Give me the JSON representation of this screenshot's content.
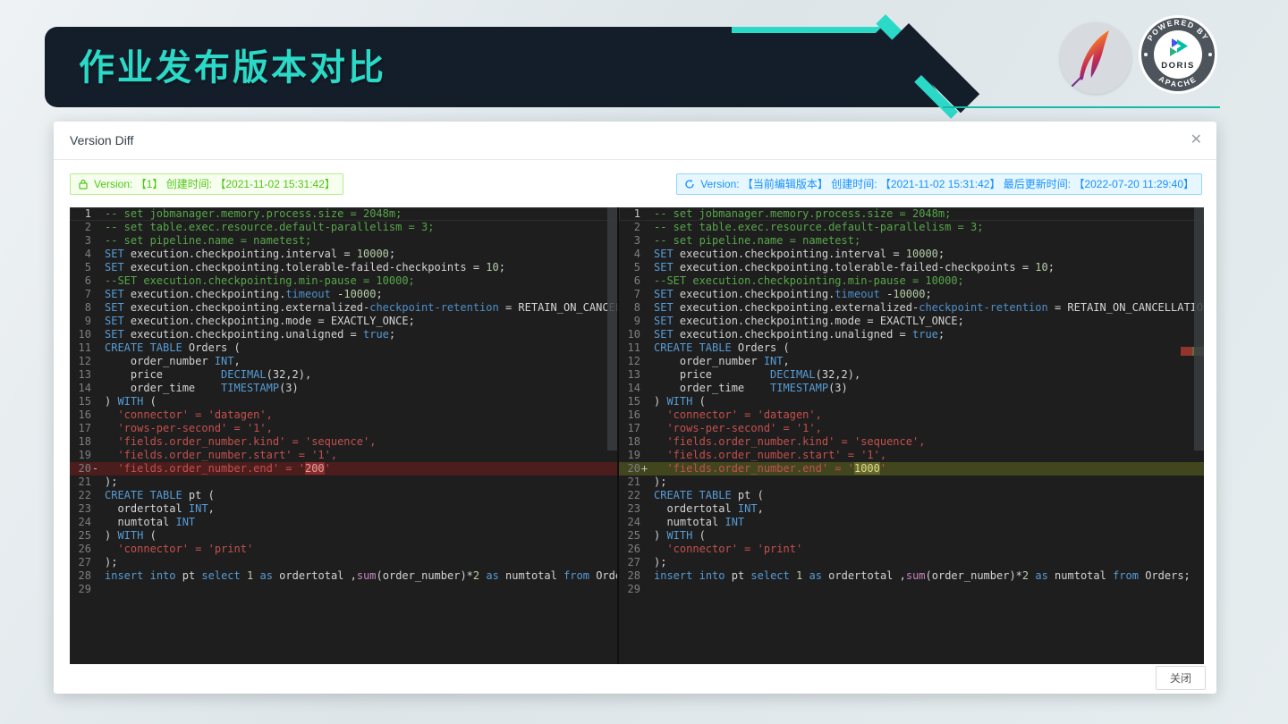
{
  "slide": {
    "title": "作业发布版本对比"
  },
  "logos": {
    "apache_feather": "apache-feather-icon",
    "doris_ring_top": "POWERED BY",
    "doris_ring_bottom": "APACHE",
    "doris_center": "DORIS"
  },
  "dialog": {
    "title": "Version Diff",
    "close_icon": "✕",
    "left_version_label": "Version: 【1】 创建时间: 【2021-11-02 15:31:42】",
    "right_version_label": "Version: 【当前编辑版本】 创建时间: 【2021-11-02 15:31:42】 最后更新时间: 【2022-07-20 11:29:40】",
    "close_button_label": "关闭"
  },
  "colors": {
    "accent_teal": "#2BD9C7",
    "header_dark": "#141E2B",
    "badge_green": "#52C41A",
    "badge_blue": "#1890FF",
    "editor_bg": "#1E1E1E",
    "diff_delete_row": "#4B1D1D",
    "diff_delete_char": "#8A2B2B",
    "diff_insert_row": "#41461F",
    "diff_insert_char": "#63692B"
  },
  "editor": {
    "diff_line_number": 20,
    "left_sign": "-",
    "right_sign": "+",
    "left_line_20": [
      [
        "s",
        "  'fields.order_number.end' = '"
      ],
      [
        "sv",
        "200"
      ],
      [
        "s",
        "'"
      ]
    ],
    "right_line_20": [
      [
        "s",
        "  'fields.order_number.end' = '"
      ],
      [
        "sv",
        "1000"
      ],
      [
        "s",
        "'"
      ]
    ],
    "lines": [
      [
        [
          "c",
          "-- set jobmanager.memory.process.size = 2048m;"
        ]
      ],
      [
        [
          "c",
          "-- set table.exec.resource.default-parallelism = 3;"
        ]
      ],
      [
        [
          "c",
          "-- set pipeline.name = nametest;"
        ]
      ],
      [
        [
          "k",
          "SET"
        ],
        [
          "t",
          " execution.checkpointing.interval = "
        ],
        [
          "n",
          "10000"
        ],
        [
          "t",
          ";"
        ]
      ],
      [
        [
          "k",
          "SET"
        ],
        [
          "t",
          " execution.checkpointing.tolerable-failed-checkpoints = "
        ],
        [
          "n",
          "10"
        ],
        [
          "t",
          ";"
        ]
      ],
      [
        [
          "c",
          "--SET execution.checkpointing.min-pause = 10000;"
        ]
      ],
      [
        [
          "k",
          "SET"
        ],
        [
          "t",
          " execution.checkpointing."
        ],
        [
          "k2",
          "timeout"
        ],
        [
          "t",
          " -"
        ],
        [
          "n",
          "10000"
        ],
        [
          "t",
          ";"
        ]
      ],
      [
        [
          "k",
          "SET"
        ],
        [
          "t",
          " execution.checkpointing.externalized-"
        ],
        [
          "k2",
          "checkpoint-retention"
        ],
        [
          "t",
          " = RETAIN_ON_CANCELLATION;"
        ]
      ],
      [
        [
          "k",
          "SET"
        ],
        [
          "t",
          " execution.checkpointing.mode = EXACTLY_ONCE;"
        ]
      ],
      [
        [
          "k",
          "SET"
        ],
        [
          "t",
          " execution.checkpointing.unaligned = "
        ],
        [
          "k",
          "true"
        ],
        [
          "t",
          ";"
        ]
      ],
      [
        [
          "k",
          "CREATE TABLE"
        ],
        [
          "t",
          " Orders ("
        ]
      ],
      [
        [
          "t",
          "    order_number "
        ],
        [
          "k",
          "INT"
        ],
        [
          "t",
          ","
        ]
      ],
      [
        [
          "t",
          "    price         "
        ],
        [
          "k",
          "DECIMAL"
        ],
        [
          "t",
          "(32,2),"
        ]
      ],
      [
        [
          "t",
          "    order_time    "
        ],
        [
          "k",
          "TIMESTAMP"
        ],
        [
          "t",
          "(3)"
        ]
      ],
      [
        [
          "t",
          ") "
        ],
        [
          "k",
          "WITH"
        ],
        [
          "t",
          " ("
        ]
      ],
      [
        [
          "s",
          "  'connector' = 'datagen',"
        ]
      ],
      [
        [
          "s",
          "  'rows-per-second' = '1',"
        ]
      ],
      [
        [
          "s",
          "  'fields.order_number.kind' = 'sequence',"
        ]
      ],
      [
        [
          "s",
          "  'fields.order_number.start' = '1',"
        ]
      ],
      {
        "diff": true
      },
      [
        [
          "t",
          ");"
        ]
      ],
      [
        [
          "k",
          "CREATE TABLE"
        ],
        [
          "t",
          " pt ("
        ]
      ],
      [
        [
          "t",
          "  ordertotal "
        ],
        [
          "k",
          "INT"
        ],
        [
          "t",
          ","
        ]
      ],
      [
        [
          "t",
          "  numtotal "
        ],
        [
          "k",
          "INT"
        ]
      ],
      [
        [
          "t",
          ") "
        ],
        [
          "k",
          "WITH"
        ],
        [
          "t",
          " ("
        ]
      ],
      [
        [
          "s",
          "  'connector' = 'print'"
        ]
      ],
      [
        [
          "t",
          ");"
        ]
      ],
      [
        [
          "k",
          "insert"
        ],
        [
          "t",
          " "
        ],
        [
          "k",
          "into"
        ],
        [
          "t",
          " pt "
        ],
        [
          "k",
          "select"
        ],
        [
          "t",
          " "
        ],
        [
          "n",
          "1"
        ],
        [
          "t",
          " "
        ],
        [
          "k",
          "as"
        ],
        [
          "t",
          " ordertotal ,"
        ],
        [
          "f",
          "sum"
        ],
        [
          "t",
          "(order_number)*"
        ],
        [
          "n",
          "2"
        ],
        [
          "t",
          " "
        ],
        [
          "k",
          "as"
        ],
        [
          "t",
          " numtotal "
        ],
        [
          "k",
          "from"
        ],
        [
          "t",
          " Orders;"
        ]
      ],
      []
    ]
  }
}
